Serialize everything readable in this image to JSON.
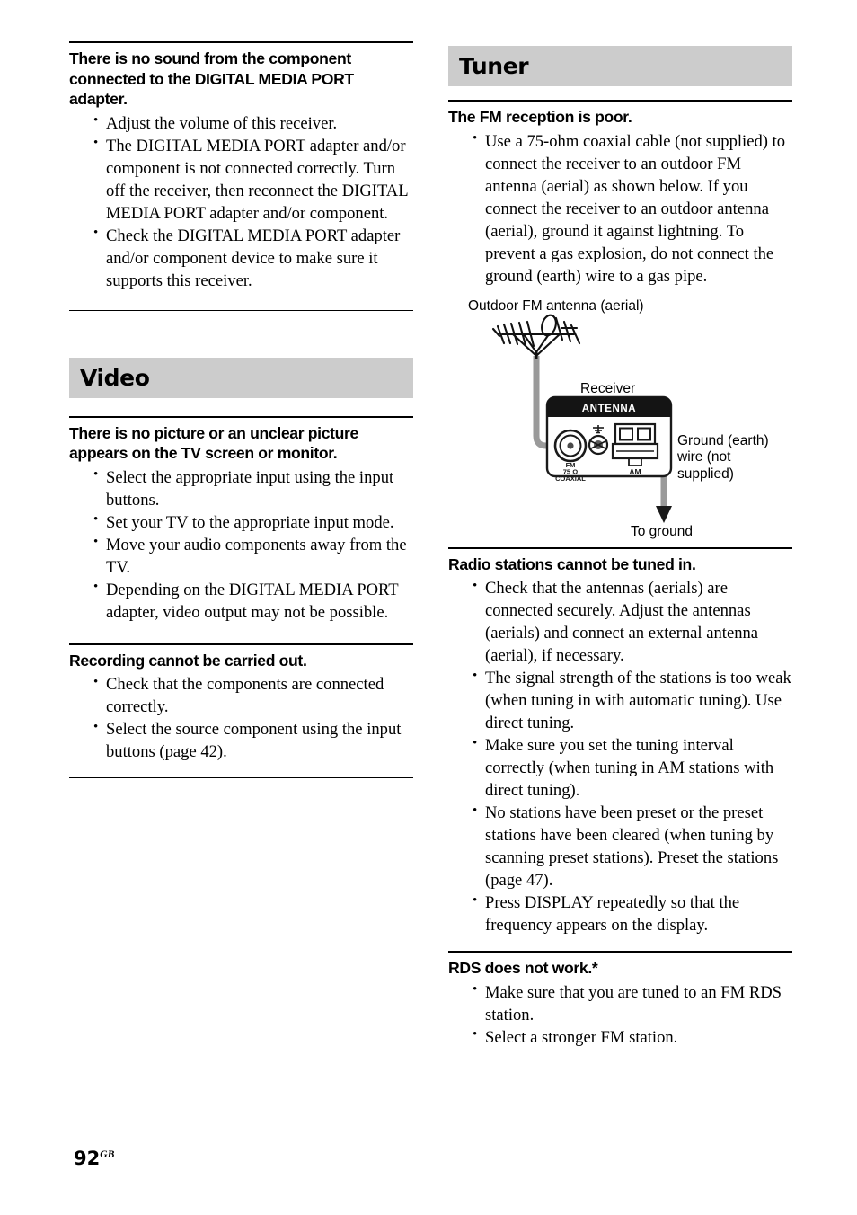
{
  "page": {
    "number": "92",
    "region_code": "GB"
  },
  "left_column": {
    "sections": [
      {
        "kind": "qa",
        "heading": "There is no sound from the component connected to the DIGITAL MEDIA PORT adapter.",
        "bullets": [
          "Adjust the volume of this receiver.",
          "The DIGITAL MEDIA PORT adapter and/or component is not connected correctly. Turn off the receiver, then reconnect the DIGITAL MEDIA PORT adapter and/or component.",
          "Check the DIGITAL MEDIA PORT adapter and/or component device to make sure it supports this receiver."
        ]
      }
    ],
    "video_section": {
      "banner_title": "Video",
      "items": [
        {
          "heading": "There is no picture or an unclear picture appears on the TV screen or monitor.",
          "bullets": [
            "Select the appropriate input using the input buttons.",
            "Set your TV to the appropriate input mode.",
            "Move your audio components away from the TV.",
            "Depending on the DIGITAL MEDIA PORT adapter, video output may not be possible."
          ]
        },
        {
          "heading": "Recording cannot be carried out.",
          "bullets": [
            "Check that the components are connected correctly.",
            "Select the source component using the input buttons (page 42)."
          ]
        }
      ]
    }
  },
  "right_column": {
    "tuner_section": {
      "banner_title": "Tuner",
      "items": [
        {
          "heading": "The FM reception is poor.",
          "bullets": [
            "Use a 75-ohm coaxial cable (not supplied) to connect the receiver to an outdoor FM antenna (aerial) as shown below. If you connect the receiver to an outdoor antenna (aerial), ground it against lightning. To prevent a gas explosion, do not connect the ground (earth) wire to a gas pipe."
          ]
        },
        {
          "heading": "Radio stations cannot be tuned in.",
          "bullets": [
            "Check that the antennas (aerials) are connected securely. Adjust the antennas (aerials) and connect an external antenna (aerial), if necessary.",
            "The signal strength of the stations is too weak (when tuning in with automatic tuning). Use direct tuning.",
            "Make sure you set the tuning interval correctly (when tuning in AM stations with direct tuning).",
            "No stations have been preset or the preset stations have been cleared (when tuning by scanning preset stations). Preset the stations (page 47).",
            "Press DISPLAY repeatedly so that the frequency appears on the display."
          ]
        },
        {
          "heading": "RDS does not work.*",
          "bullets": [
            "Make sure that you are tuned to an FM RDS station.",
            "Select a stronger FM station."
          ]
        }
      ]
    },
    "figure": {
      "label_outdoor_antenna": "Outdoor FM antenna (aerial)",
      "label_receiver": "Receiver",
      "label_ground_wire": "Ground (earth) wire (not supplied)",
      "label_to_ground": "To ground",
      "panel": {
        "header": "ANTENNA",
        "fm_label_line1": "FM",
        "fm_label_line2": "75 Ω",
        "fm_label_line3": "COAXIAL",
        "am_label": "AM"
      }
    }
  },
  "colors": {
    "banner_gray": "#cccccc",
    "wire_gray": "#999999",
    "panel_header_black": "#141414",
    "text_black": "#000000"
  }
}
